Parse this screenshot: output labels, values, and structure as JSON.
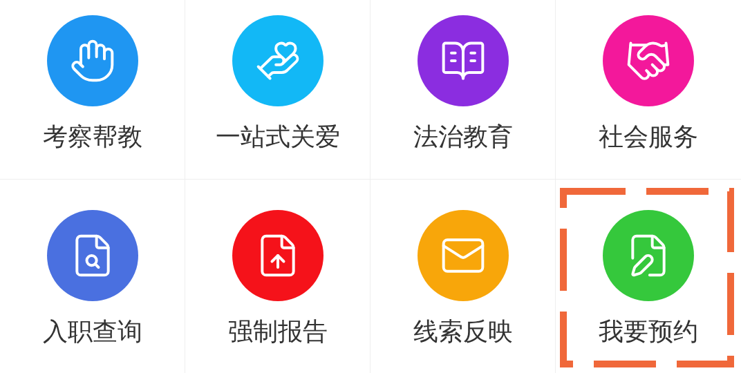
{
  "items": [
    {
      "label": "考察帮教",
      "kind": "hand",
      "color": "#1f96f2",
      "highlighted": false
    },
    {
      "label": "一站式关爱",
      "kind": "care",
      "color": "#12b8f6",
      "highlighted": false
    },
    {
      "label": "法治教育",
      "kind": "book",
      "color": "#8b2de0",
      "highlighted": false
    },
    {
      "label": "社会服务",
      "kind": "handshake",
      "color": "#f3189b",
      "highlighted": false
    },
    {
      "label": "入职查询",
      "kind": "search",
      "color": "#4a70e0",
      "highlighted": false
    },
    {
      "label": "强制报告",
      "kind": "report",
      "color": "#f5121a",
      "highlighted": false
    },
    {
      "label": "线索反映",
      "kind": "mail",
      "color": "#f8a60a",
      "highlighted": false
    },
    {
      "label": "我要预约",
      "kind": "edit",
      "color": "#35c83c",
      "highlighted": true
    }
  ]
}
